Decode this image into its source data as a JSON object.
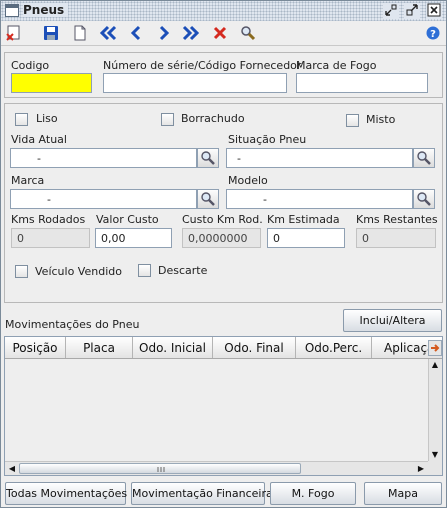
{
  "window": {
    "title": "Pneus"
  },
  "toolbar": {
    "icons": [
      "clear-icon",
      "save-icon",
      "new-document-icon",
      "first-record-icon",
      "previous-record-icon",
      "next-record-icon",
      "last-record-icon",
      "delete-icon",
      "search-icon",
      "help-icon"
    ]
  },
  "header_panel": {
    "codigo_label": "Codigo",
    "codigo_value": "",
    "serie_label": "Número de série/Código Fornecedor",
    "serie_value": "",
    "marca_fogo_label": "Marca de Fogo",
    "marca_fogo_value": ""
  },
  "details_panel": {
    "liso_label": "Liso",
    "borrachudo_label": "Borrachudo",
    "misto_label": "Misto",
    "vida_atual_label": "Vida Atual",
    "vida_atual_value": "-",
    "situacao_label": "Situação Pneu",
    "situacao_value": "-",
    "marca_label": "Marca",
    "marca_value": "-",
    "modelo_label": "Modelo",
    "modelo_value": "-",
    "kms_rodados_label": "Kms Rodados",
    "kms_rodados_value": "0",
    "valor_custo_label": "Valor Custo",
    "valor_custo_value": "0,00",
    "custo_km_label": "Custo Km Rod.",
    "custo_km_value": "0,0000000",
    "km_estimada_label": "Km Estimada",
    "km_estimada_value": "0",
    "kms_restantes_label": "Kms Restantes",
    "kms_restantes_value": "0",
    "veiculo_vendido_label": "Veículo Vendido",
    "descarte_label": "Descarte"
  },
  "movements": {
    "section_label": "Movimentações do Pneu",
    "include_button": "Inclui/Altera",
    "columns": [
      "Posição",
      "Placa",
      "Odo. Inicial",
      "Odo. Final",
      "Odo.Perc.",
      "Aplicação"
    ]
  },
  "bottom_buttons": {
    "todas": "Todas Movimentações",
    "financeira": "Movimentação Financeira",
    "mfogo": "M. Fogo",
    "mapa": "Mapa"
  },
  "colors": {
    "required_field": "#ffff00",
    "nav_icons": "#1c4fb8",
    "delete_icon": "#d42a1f"
  }
}
